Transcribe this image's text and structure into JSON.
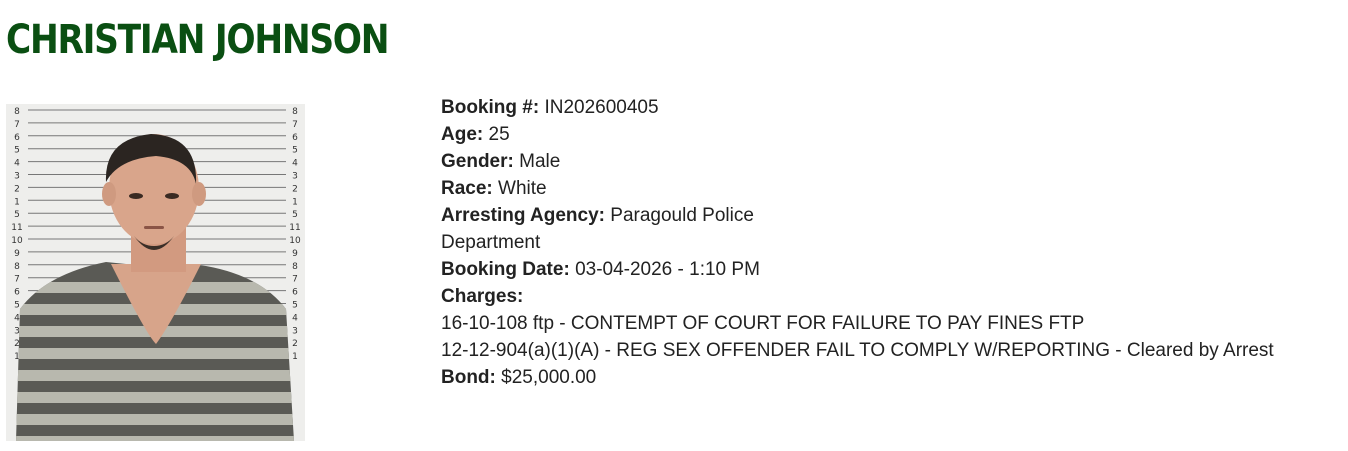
{
  "colors": {
    "title": "#0a4f12",
    "text": "#222222",
    "background": "#ffffff"
  },
  "inmate": {
    "name": "CHRISTIAN JOHNSON"
  },
  "details": {
    "booking_number_label": "Booking #:",
    "booking_number": "IN202600405",
    "age_label": "Age:",
    "age": "25",
    "gender_label": "Gender:",
    "gender": "Male",
    "race_label": "Race:",
    "race": "White",
    "arresting_agency_label": "Arresting Agency:",
    "arresting_agency": "Paragould Police Department",
    "booking_date_label": "Booking Date:",
    "booking_date": "03-04-2026 - 1:10 PM",
    "charges_label": "Charges:",
    "charges": [
      "16-10-108 ftp - CONTEMPT OF COURT FOR FAILURE TO PAY FINES FTP",
      "12-12-904(a)(1)(A) - REG SEX OFFENDER FAIL TO COMPLY W/REPORTING - Cleared by Arrest"
    ],
    "bond_label": "Bond:",
    "bond": "$25,000.00"
  },
  "mugshot": {
    "height_chart_marks_left": [
      "8",
      "7",
      "6",
      "5",
      "4",
      "3",
      "2",
      "1",
      "5",
      "11",
      "10",
      "9",
      "8",
      "7",
      "6",
      "5",
      "4",
      "3",
      "2",
      "1"
    ],
    "height_chart_marks_right": [
      "8",
      "7",
      "6",
      "5",
      "4",
      "3",
      "2",
      "1",
      "5",
      "11",
      "10",
      "9",
      "8",
      "7",
      "6",
      "5",
      "4",
      "3",
      "2",
      "1"
    ]
  }
}
